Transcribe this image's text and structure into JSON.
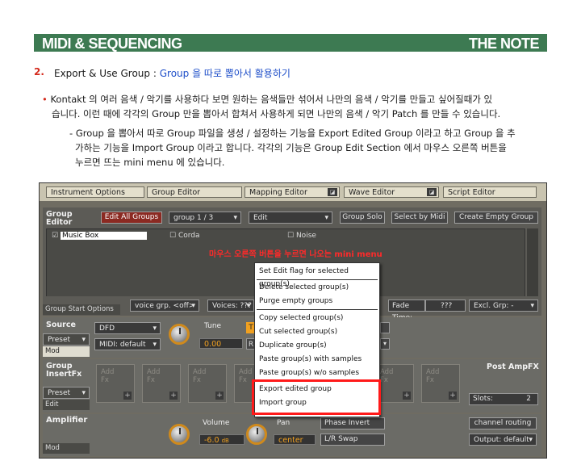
{
  "header": {
    "left": "MIDI & SEQUENCING",
    "right": "THE NOTE"
  },
  "section": {
    "number": "2.",
    "title_prefix": "Export & Use Group : ",
    "title_blue": "Group 을 따로 뽑아서 활용하기"
  },
  "paragraphs": {
    "p1_line1": "Kontakt 의 여러 음색 / 악기를 사용하다 보면 원하는 음색들만 섞어서 나만의 음색 / 악기를 만들고 싶어질때가 있",
    "p1_line2": "습니다. 이런 때에 각각의 Group 만을 뽑아서 합쳐서 사용하게 되면 나만의 음색 / 악기 Patch 를 만들 수 있습니다.",
    "p2_line1": "Group 을 뽑아서 따로 Group 파일을 생성 / 설정하는 기능을 Export Edited Group 이라고 하고 Group 을 추",
    "p2_line2": "가하는 기능을 Import Group 이라고 합니다. 각각의 기능은 Group Edit Section 에서 마우스 오른쪽 버튼을",
    "p2_line3": "누르면 뜨는 mini menu 에 있습니다."
  },
  "screenshot": {
    "tabs": [
      "Instrument Options",
      "Group Editor",
      "Mapping Editor",
      "Wave Editor",
      "Script Editor"
    ],
    "group_editor": {
      "label_line1": "Group",
      "label_line2": "Editor",
      "edit_all_groups": "Edit All Groups",
      "group_select": "group 1 / 3",
      "edit_select": "Edit",
      "group_solo": "Group Solo",
      "select_by_midi": "Select by Midi",
      "create_empty_group": "Create Empty Group",
      "groups": [
        "Music Box",
        "Corda",
        "Noise"
      ],
      "annotation": "마우스 오른쪽 버튼을 누르면 나오는 mini menu"
    },
    "context_menu": {
      "items": [
        "Set Edit flag for selected group(s)",
        "Delete selected group(s)",
        "Purge empty groups",
        "Copy selected group(s)",
        "Cut selected group(s)",
        "Duplicate group(s)",
        "Paste group(s) with samples",
        "Paste group(s) w/o samples",
        "Export edited group",
        "Import group"
      ]
    },
    "group_start": {
      "label": "Group Start Options",
      "voice_grp": "voice grp. <off>",
      "voices": "Voices: ???",
      "fade_time_label": "Fade Time:",
      "fade_time_value": "???",
      "excl_grp": "Excl. Grp: -"
    },
    "source": {
      "label": "Source",
      "preset": "Preset",
      "mod": "Mod",
      "engine": "DFD",
      "midi": "MIDI: default",
      "tune_label": "Tune",
      "tune_value": "0.00",
      "tracking_short": "T",
      "r_short": "R"
    },
    "insert_fx": {
      "label_line1": "Group",
      "label_line2": "InsertFx",
      "preset": "Preset",
      "edit": "Edit",
      "slot_line1": "Add",
      "slot_line2": "Fx",
      "post_amp_fx": "Post AmpFX",
      "slots_label": "Slots:",
      "slots_value": "2"
    },
    "amplifier": {
      "label": "Amplifier",
      "mod": "Mod",
      "volume_label": "Volume",
      "volume_value": "-6.0",
      "volume_unit": "dB",
      "pan_label": "Pan",
      "pan_value": "center",
      "phase_invert": "Phase Invert",
      "lr_swap": "L/R Swap",
      "channel_routing": "channel routing",
      "output": "Output: default"
    }
  },
  "colors": {
    "header_green": "#3d7a52",
    "accent_red": "#d42a1c",
    "link_blue": "#1f4fc9",
    "knob_orange": "#d08a1c"
  }
}
